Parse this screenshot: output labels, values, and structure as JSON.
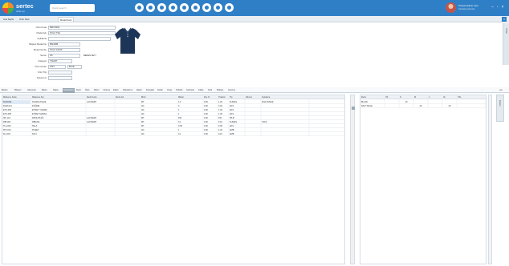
{
  "header": {
    "brand": "sertec",
    "brand_sub": "textile erp",
    "search_placeholder": "Quick search",
    "nav_icons": [
      "home-icon",
      "grid-icon",
      "list-icon",
      "chart-icon",
      "settings-icon",
      "user-icon",
      "mail-icon",
      "calendar-icon",
      "help-icon"
    ],
    "user_name": "Product Admin User",
    "user_sub": "Company Account",
    "colors": {
      "bar": "#2f7fc6",
      "accent": "#f28c28"
    }
  },
  "tabs": [
    {
      "label": "Ana Sayfa"
    },
    {
      "label": "Ürün Kartı"
    },
    {
      "label": "Model Kartı"
    }
  ],
  "form": {
    "fields": [
      {
        "label": "Ürün Kodu",
        "value": "BRN-5003"
      },
      {
        "label": "Model Adı",
        "value": "POLO TSH"
      },
      {
        "label": "Açıklama",
        "value": ""
      },
      {
        "label": "Müşteri Model No",
        "value": "MM4288"
      },
      {
        "label": "Model Grubu",
        "value": "POLO GRUP"
      },
      {
        "label": "Sezon",
        "value": "SS"
      },
      {
        "label": "Kategori",
        "value": "TSHIRT"
      },
      {
        "label": "Ürün Grubu",
        "value": "KNIT"
      },
      {
        "label": "Ürün Tipi",
        "value": ""
      },
      {
        "label": "Tasarımcı",
        "value": ""
      }
    ],
    "inline_label": "BEDEN SETİ",
    "extra_box": "BLUE"
  },
  "side_tab_label": "Notlar",
  "detail_tabs": [
    "Beden",
    "Bileşen",
    "Aksesuar",
    "Baskı",
    "Nakış",
    "Operasyon",
    "Fiyat",
    "Ölçü",
    "Dikim",
    "Yıkama",
    "Etiket",
    "Paketleme",
    "Rapor",
    "Dosyalar",
    "Notlar",
    "Onay",
    "Tedarik",
    "Sevkiyat",
    "Kalite",
    "Stok",
    "Maliyet",
    "Geçmiş"
  ],
  "active_detail_tab": 5,
  "main_table": {
    "columns": [
      "Malzeme Kodu",
      "Malzeme Adı",
      "Renk Kodu",
      "Renk Adı",
      "Birim",
      "Miktar",
      "Fire %",
      "Tüketim",
      "Tip",
      "Dönem",
      "Açıklama"
    ],
    "rows": [
      [
        "KUM-001",
        "KUMAŞ PIQUE",
        "LACİVERT",
        "",
        "MT",
        "1.2",
        "0.00",
        "1.20",
        "KUMAŞ",
        "",
        "ANA KUMAŞ"
      ],
      [
        "DGM-012",
        "DÜĞME",
        "",
        "",
        "AD",
        "3",
        "0.00",
        "3.00",
        "AKS",
        "",
        ""
      ],
      [
        "ETK-005",
        "ETİKET YIKAMA",
        "",
        "",
        "AD",
        "1",
        "0.00",
        "1.00",
        "AKS",
        "",
        ""
      ],
      [
        "ETK-008",
        "ETİKET MARKA",
        "",
        "",
        "AD",
        "1",
        "0.00",
        "1.00",
        "AKS",
        "",
        ""
      ],
      [
        "IPL-101",
        "DİKİŞ İPLİĞİ",
        "LACİVERT",
        "",
        "MT",
        "150",
        "0.00",
        "150",
        "İPLİK",
        "",
        ""
      ],
      [
        "RIB-004",
        "RİBANA",
        "LACİVERT",
        "",
        "MT",
        "0.1",
        "0.00",
        "0.10",
        "KUMAŞ",
        "",
        "YAKA"
      ],
      [
        "TLA-002",
        "TELA",
        "",
        "",
        "MT",
        "0.05",
        "0.00",
        "0.05",
        "AKS",
        "",
        ""
      ],
      [
        "PKT-010",
        "POŞET",
        "",
        "",
        "AD",
        "1",
        "0.00",
        "1.00",
        "AMB",
        "",
        ""
      ],
      [
        "KLI-003",
        "KOLİ",
        "",
        "",
        "AD",
        "0.1",
        "0.00",
        "0.10",
        "AMB",
        "",
        ""
      ]
    ]
  },
  "size_grid": {
    "columns": [
      "Renk",
      "XS",
      "S",
      "M",
      "L",
      "XL",
      "XXL"
    ],
    "rows": [
      [
        "BLACK",
        "",
        "10",
        "",
        "",
        "",
        ""
      ],
      [
        "NAVY BLUE",
        "",
        "",
        "20",
        "",
        "20",
        ""
      ]
    ]
  },
  "right_tab_label": "Beden"
}
